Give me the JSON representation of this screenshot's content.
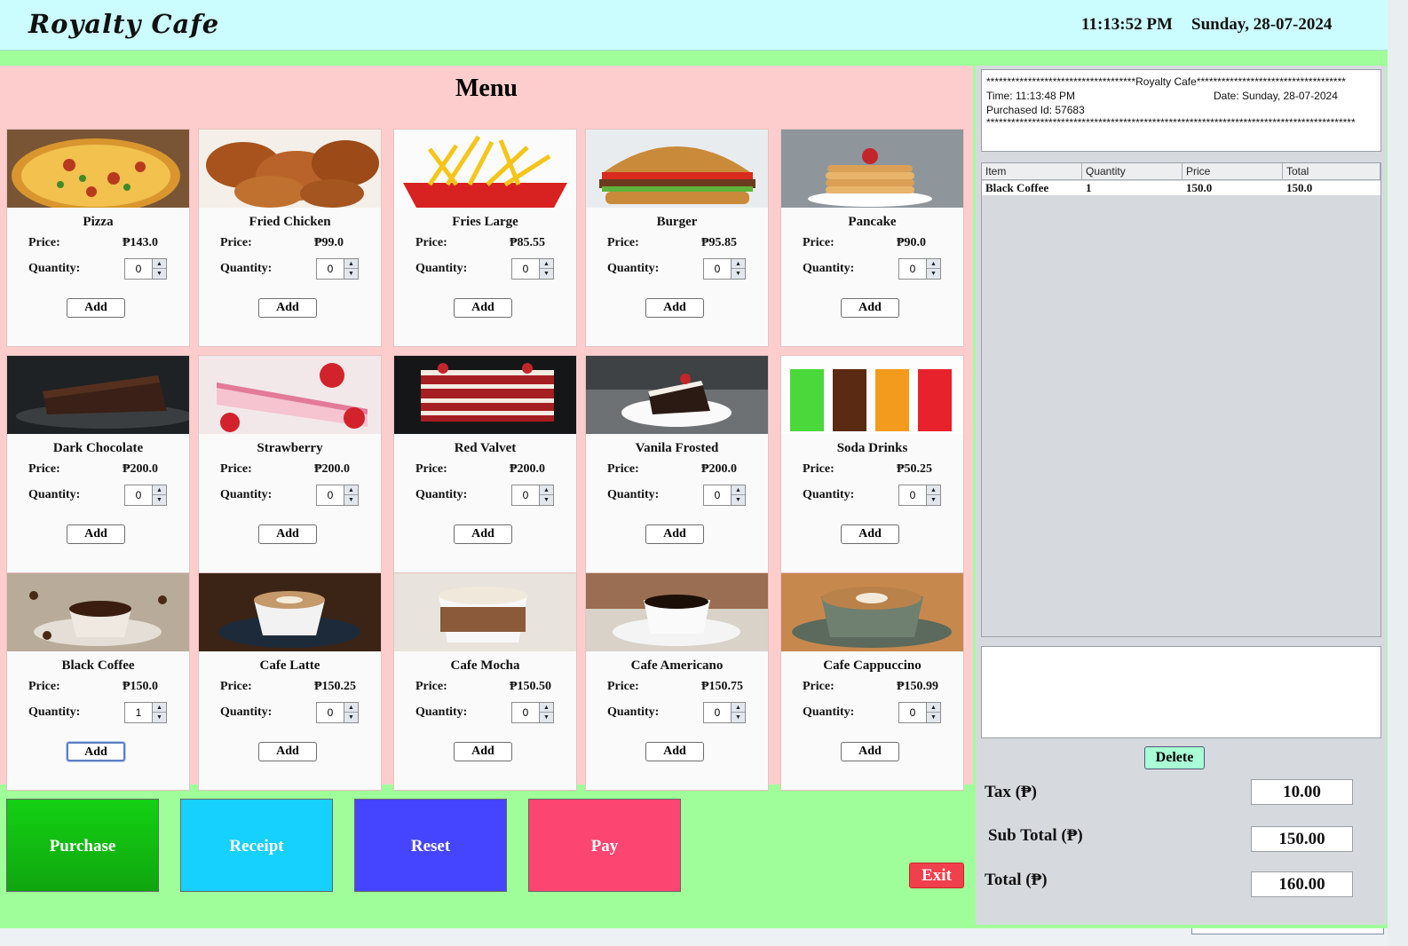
{
  "header": {
    "app_title": "Royalty Cafe",
    "time": "11:13:52 PM",
    "date": "Sunday, 28-07-2024"
  },
  "menu": {
    "title": "Menu",
    "price_label": "Price:",
    "quantity_label": "Quantity:",
    "add_label": "Add",
    "items": [
      {
        "name": "Pizza",
        "price": "₱143.0",
        "qty": "0",
        "icon": "pizza-image"
      },
      {
        "name": "Fried Chicken",
        "price": "₱99.0",
        "qty": "0",
        "icon": "fried-chicken-image"
      },
      {
        "name": "Fries Large",
        "price": "₱85.55",
        "qty": "0",
        "icon": "fries-image"
      },
      {
        "name": "Burger",
        "price": "₱95.85",
        "qty": "0",
        "icon": "burger-image"
      },
      {
        "name": "Pancake",
        "price": "₱90.0",
        "qty": "0",
        "icon": "pancake-image"
      },
      {
        "name": "Dark Chocolate",
        "price": "₱200.0",
        "qty": "0",
        "icon": "chocolate-cake-image"
      },
      {
        "name": "Strawberry",
        "price": "₱200.0",
        "qty": "0",
        "icon": "strawberry-cake-image"
      },
      {
        "name": "Red Valvet",
        "price": "₱200.0",
        "qty": "0",
        "icon": "red-velvet-image"
      },
      {
        "name": "Vanila Frosted",
        "price": "₱200.0",
        "qty": "0",
        "icon": "vanilla-cake-image"
      },
      {
        "name": "Soda Drinks",
        "price": "₱50.25",
        "qty": "0",
        "icon": "soda-image"
      },
      {
        "name": "Black Coffee",
        "price": "₱150.0",
        "qty": "1",
        "icon": "black-coffee-image"
      },
      {
        "name": "Cafe Latte",
        "price": "₱150.25",
        "qty": "0",
        "icon": "latte-image"
      },
      {
        "name": "Cafe Mocha",
        "price": "₱150.50",
        "qty": "0",
        "icon": "mocha-image"
      },
      {
        "name": "Cafe Americano",
        "price": "₱150.75",
        "qty": "0",
        "icon": "americano-image"
      },
      {
        "name": "Cafe Cappuccino",
        "price": "₱150.99",
        "qty": "0",
        "icon": "cappuccino-image"
      }
    ]
  },
  "actions": {
    "purchase": "Purchase",
    "receipt": "Receipt",
    "reset": "Reset",
    "pay": "Pay",
    "exit": "Exit"
  },
  "receipt": {
    "header_line": "************************************Royalty Cafe************************************",
    "time": "Time: 11:13:48 PM",
    "date": "Date: Sunday, 28-07-2024",
    "purchase_id": "Purchased Id: 57683",
    "footer_line": "*****************************************************************************************"
  },
  "order_table": {
    "columns": [
      "Item",
      "Quantity",
      "Price",
      "Total"
    ],
    "rows": [
      [
        "Black Coffee",
        "1",
        "150.0",
        "150.0"
      ]
    ]
  },
  "delete_label": "Delete",
  "summary": {
    "tax_label": "Tax (₱)",
    "tax": "10.00",
    "subtotal_label": "Sub Total (₱)",
    "subtotal": "150.00",
    "total_label": "Total (₱)",
    "total": "160.00"
  },
  "colors": {
    "background": "#9ffe9a",
    "header": "#ccfdfe",
    "menu_panel": "#fdcdcd",
    "purchase": "#13cf13",
    "receipt": "#16d0fe",
    "reset": "#4545ff",
    "pay": "#fd4572",
    "exit": "#f0404d",
    "delete": "#a9ffd6"
  }
}
